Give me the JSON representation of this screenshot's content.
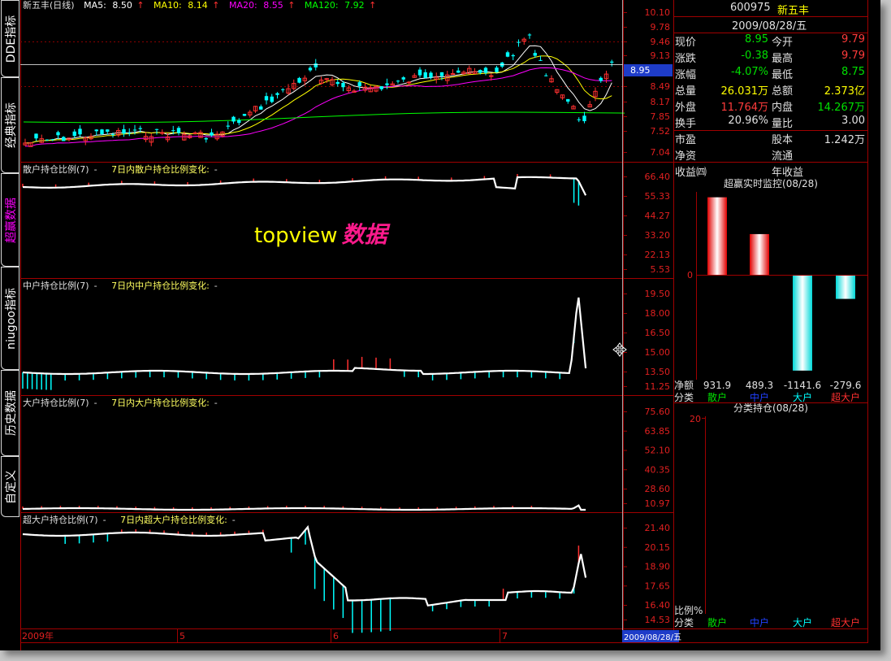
{
  "panel_tabs": [
    "DDE指标",
    "经典指标",
    "超赢数据",
    "niugoo指标",
    "历史数据",
    "自定义"
  ],
  "price_chart": {
    "name": "新五丰(日线)",
    "ma": [
      {
        "label": "MA5:",
        "value": "8.50",
        "color": "#ffffff"
      },
      {
        "label": "MA10:",
        "value": "8.14",
        "color": "#ffff00"
      },
      {
        "label": "MA20:",
        "value": "8.55",
        "color": "#ff00ff"
      },
      {
        "label": "MA120:",
        "value": "7.92",
        "color": "#00ff00"
      }
    ],
    "y_ticks": [
      "10.10",
      "9.78",
      "9.46",
      "9.13",
      "8.81",
      "8.49",
      "8.17",
      "7.85",
      "7.52",
      "7.04"
    ],
    "current_price": "8.95"
  },
  "sub_charts": [
    {
      "title": "散户持仓比例(7)",
      "subtitle": "7日内散户持仓比例变化:",
      "dash": "-",
      "y_ticks": [
        "66.40",
        "55.33",
        "44.27",
        "33.20",
        "22.13",
        "5.53"
      ]
    },
    {
      "title": "中户持仓比例(7)",
      "subtitle": "7日内中户持仓比例变化:",
      "dash": "-",
      "y_ticks": [
        "19.50",
        "18.00",
        "16.50",
        "15.00",
        "13.50",
        "11.25"
      ]
    },
    {
      "title": "大户持仓比例(7)",
      "subtitle": "7日内大户持仓比例变化:",
      "dash": "-",
      "y_ticks": [
        "75.60",
        "63.85",
        "52.10",
        "40.35",
        "28.60",
        "10.97"
      ]
    },
    {
      "title": "超大户持仓比例(7)",
      "subtitle": "7日内超大户持仓比例变化:",
      "dash": "-",
      "y_ticks": [
        "21.40",
        "20.15",
        "18.90",
        "17.65",
        "16.40",
        "14.53"
      ]
    }
  ],
  "watermark": {
    "latin": "topview",
    "cn": "数据"
  },
  "x_axis": {
    "labels": [
      "2009年",
      "5",
      "6",
      "7"
    ],
    "cursor_date": "2009/08/28/五"
  },
  "quote": {
    "code": "600975",
    "name": "新五丰",
    "date": "2009/08/28/五",
    "rows": [
      {
        "l1": "现价",
        "v1": "8.95",
        "c1": "green",
        "l2": "今开",
        "v2": "9.79",
        "c2": "red"
      },
      {
        "l1": "涨跌",
        "v1": "-0.38",
        "c1": "green",
        "l2": "最高",
        "v2": "9.79",
        "c2": "red"
      },
      {
        "l1": "涨幅",
        "v1": "-4.07%",
        "c1": "green",
        "l2": "最低",
        "v2": "8.75",
        "c2": "green"
      },
      {
        "l1": "总量",
        "v1": "26.031万",
        "c1": "yellow",
        "l2": "总额",
        "v2": "2.373亿",
        "c2": "yellow"
      },
      {
        "l1": "外盘",
        "v1": "11.764万",
        "c1": "red",
        "l2": "内盘",
        "v2": "14.267万",
        "c2": "green"
      },
      {
        "l1": "换手",
        "v1": "20.96%",
        "c1": "white",
        "l2": "量比",
        "v2": "3.00",
        "c2": "white"
      },
      {
        "l1": "市盈",
        "v1": "",
        "c1": "white",
        "l2": "股本",
        "v2": "1.242万",
        "c2": "white"
      },
      {
        "l1": "净资",
        "v1": "",
        "c1": "white",
        "l2": "流通",
        "v2": "",
        "c2": "white"
      },
      {
        "l1": "收益㈣",
        "v1": "",
        "c1": "white",
        "l2": "年收益",
        "v2": "",
        "c2": "white"
      }
    ]
  },
  "realtime_monitor": {
    "title": "超赢实时监控(08/28)",
    "zero_label": "0",
    "net_label": "净额",
    "category_label": "分类",
    "chart_data": {
      "type": "bar",
      "categories": [
        "散户",
        "中户",
        "大户",
        "超大户"
      ],
      "values": [
        931.9,
        489.3,
        -1141.6,
        -279.6
      ],
      "value_labels": [
        "931.9",
        "489.3",
        "-1141.6",
        "-279.6"
      ],
      "ylim": [
        -1280,
        1280
      ],
      "category_colors": [
        "#00e000",
        "#2040ff",
        "#00ffff",
        "#ff3030"
      ]
    }
  },
  "classification_hold": {
    "title": "分类持仓(08/28)",
    "y_top_label": "20",
    "ratio_label": "比例%",
    "category_label": "分类",
    "categories": [
      "散户",
      "中户",
      "大户",
      "超大户"
    ],
    "category_colors": [
      "#00e000",
      "#2040ff",
      "#00ffff",
      "#ff3030"
    ]
  }
}
